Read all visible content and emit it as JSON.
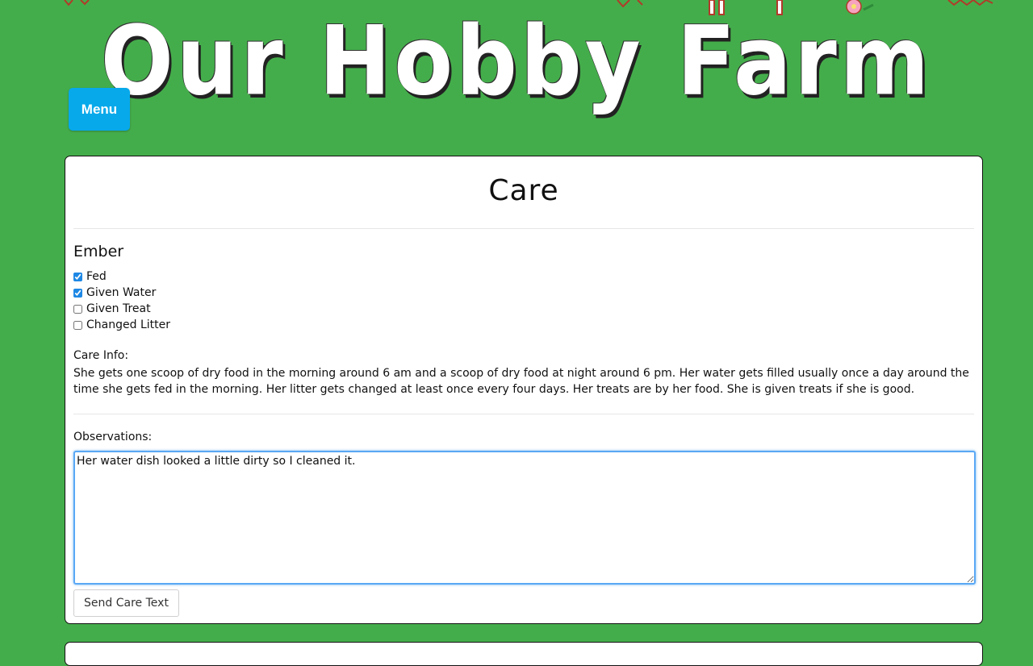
{
  "header": {
    "title": "Our Hobby Farm",
    "menu_label": "Menu"
  },
  "care": {
    "title": "Care",
    "animal_name": "Ember",
    "tasks": [
      {
        "label": "Fed",
        "checked": true
      },
      {
        "label": "Given Water",
        "checked": true
      },
      {
        "label": "Given Treat",
        "checked": false
      },
      {
        "label": "Changed Litter",
        "checked": false
      }
    ],
    "care_info_label": "Care Info:",
    "care_info_text": "She gets one scoop of dry food in the morning around 6 am and a scoop of dry food at night around 6 pm. Her water gets filled usually once a day around the time she gets fed in the morning. Her litter gets changed at least once every four days. Her treats are by her food. She is given treats if she is good.",
    "observations_label": "Observations:",
    "observations_value": "Her water dish looked a little dirty so I cleaned it.",
    "send_button_label": "Send Care Text"
  },
  "colors": {
    "background": "#44ad4b",
    "menu_button": "#07a9ea",
    "focus_border": "#5aa8f5"
  }
}
